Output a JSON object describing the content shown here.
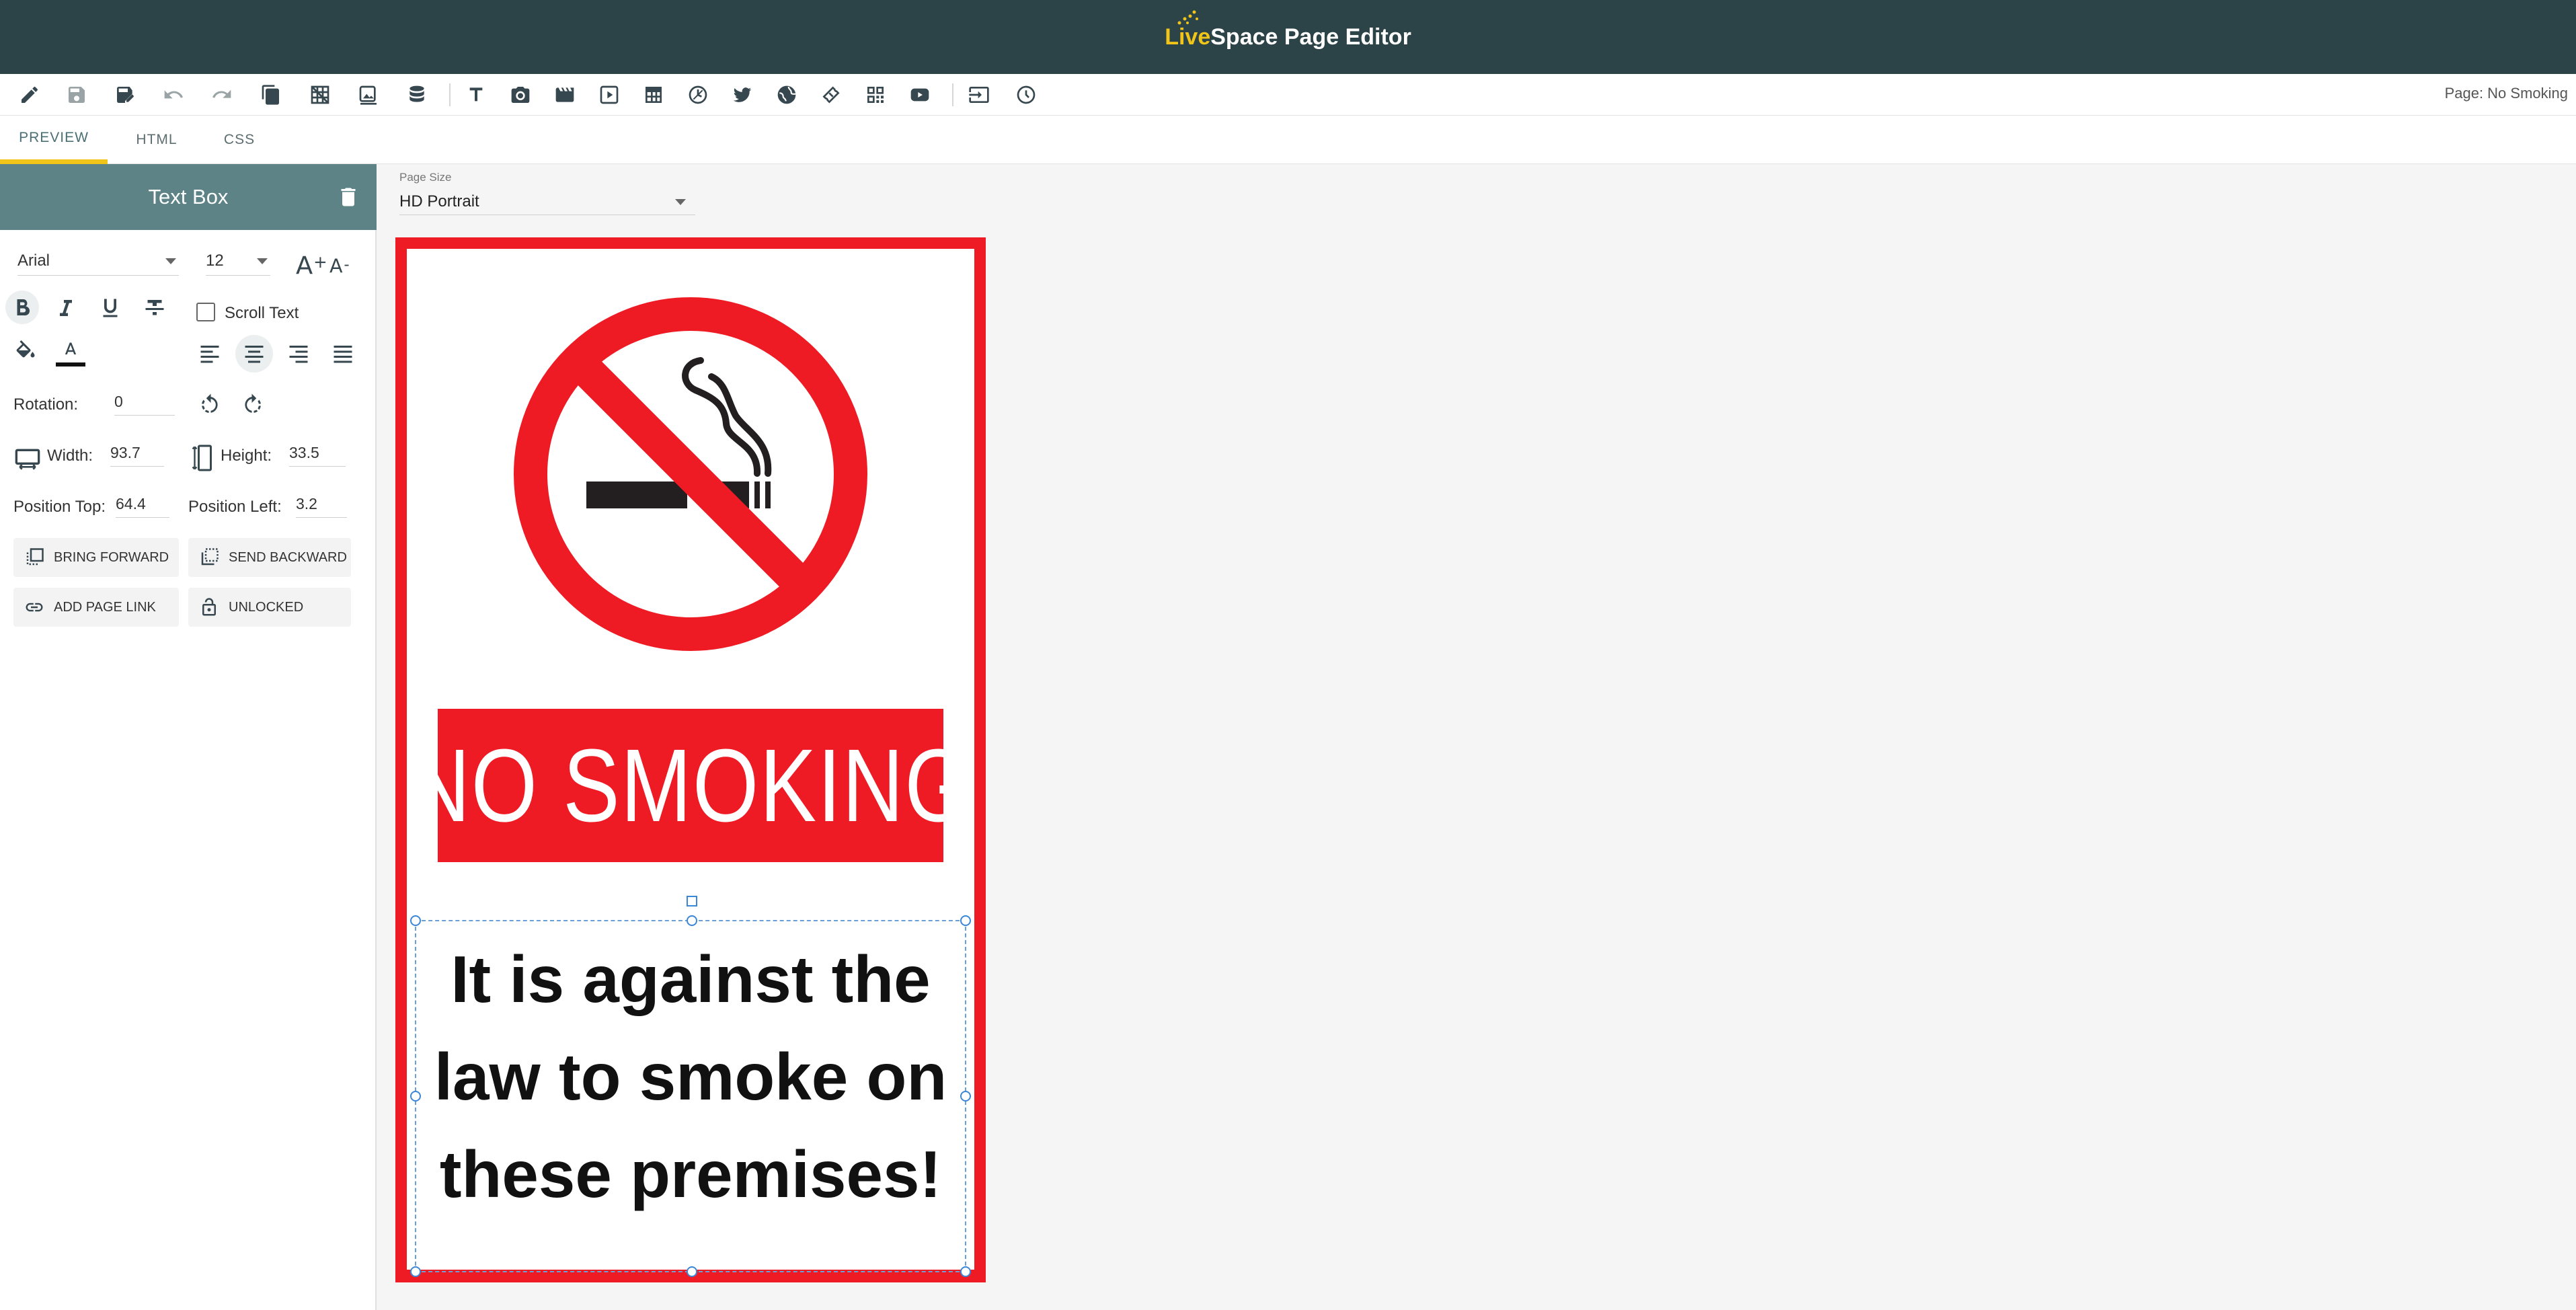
{
  "app": {
    "brand_live": "Live",
    "brand_rest": "Space Page Editor",
    "page_label": "Page: No Smoking",
    "accent": "#f0c419",
    "header_bg": "#2c4447",
    "panel_bg": "#5d8387"
  },
  "toolbar": {
    "icons": [
      "edit-icon",
      "save-icon",
      "save-as-icon",
      "undo-icon",
      "redo-icon",
      "copy-page-icon",
      "grid-icon",
      "image-edit-icon",
      "database-icon",
      "text-icon",
      "camera-icon",
      "video-clip-icon",
      "play-icon",
      "table-icon",
      "clock-widget-icon",
      "twitter-icon",
      "globe-icon",
      "ticket-icon",
      "qr-code-icon",
      "youtube-icon",
      "input-icon",
      "schedule-icon"
    ]
  },
  "tabs": [
    {
      "label": "PREVIEW",
      "active": true
    },
    {
      "label": "HTML",
      "active": false
    },
    {
      "label": "CSS",
      "active": false
    }
  ],
  "panel": {
    "title": "Text Box",
    "font": "Arial",
    "font_size": "12",
    "scroll_text_label": "Scroll Text",
    "scroll_text_checked": false,
    "rotation_label": "Rotation:",
    "rotation": "0",
    "width_label": "Width:",
    "width": "93.7",
    "height_label": "Height:",
    "height": "33.5",
    "pos_top_label": "Position Top:",
    "pos_top": "64.4",
    "pos_left_label": "Position Left:",
    "pos_left": "3.2",
    "bring_forward": "BRING FORWARD",
    "send_backward": "SEND BACKWARD",
    "add_page_link": "ADD PAGE LINK",
    "unlocked": "UNLOCKED"
  },
  "canvas": {
    "page_size_label": "Page Size",
    "page_size": "HD Portrait",
    "banner_text": "NO SMOKING",
    "body_line1": "It is against the",
    "body_line2": "law to smoke on",
    "body_line3": "these premises!",
    "sign_red": "#ef1b24"
  }
}
